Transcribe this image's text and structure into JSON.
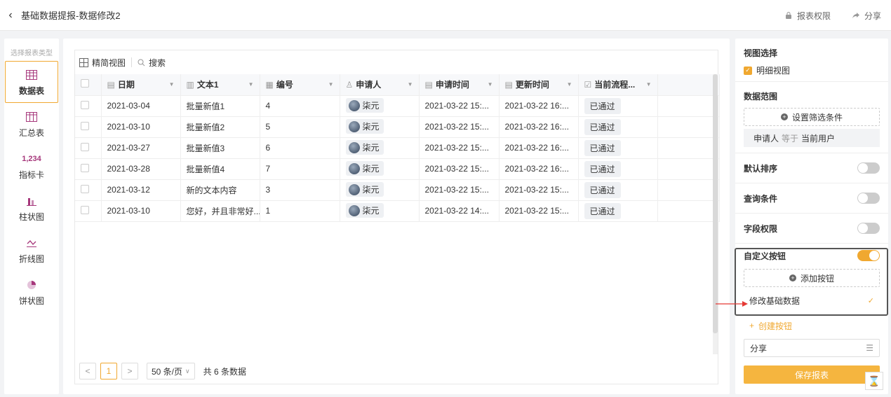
{
  "header": {
    "back_icon": "chevron-left-icon",
    "title": "基础数据提报-数据修改2",
    "actions": [
      {
        "icon": "lock-icon",
        "label": "报表权限"
      },
      {
        "icon": "share-icon",
        "label": "分享"
      }
    ]
  },
  "report_types": {
    "title": "选择报表类型",
    "items": [
      {
        "label": "数据表",
        "icon": "table-icon",
        "active": true
      },
      {
        "label": "汇总表",
        "icon": "summary-table-icon",
        "active": false
      },
      {
        "label": "指标卡",
        "icon_text": "1,234",
        "icon": "metric-card-icon",
        "active": false
      },
      {
        "label": "柱状图",
        "icon": "bar-chart-icon",
        "active": false
      },
      {
        "label": "折线图",
        "icon": "line-chart-icon",
        "active": false
      },
      {
        "label": "饼状图",
        "icon": "pie-chart-icon",
        "active": false
      }
    ]
  },
  "toolbar": {
    "compact_view": "精简视图",
    "search": "搜索"
  },
  "table": {
    "columns": [
      {
        "icon": "calendar-icon",
        "label": "日期"
      },
      {
        "icon": "text-icon",
        "label": "文本1"
      },
      {
        "icon": "number-icon",
        "label": "编号"
      },
      {
        "icon": "user-icon",
        "label": "申请人"
      },
      {
        "icon": "calendar-icon",
        "label": "申请时间"
      },
      {
        "icon": "calendar-icon",
        "label": "更新时间"
      },
      {
        "icon": "status-icon",
        "label": "当前流程..."
      }
    ],
    "rows": [
      {
        "date": "2021-03-04",
        "text": "批量新值1",
        "num": "4",
        "applicant": "柒元",
        "apply_time": "2021-03-22 15:...",
        "update_time": "2021-03-22 16:...",
        "status": "已通过"
      },
      {
        "date": "2021-03-10",
        "text": "批量新值2",
        "num": "5",
        "applicant": "柒元",
        "apply_time": "2021-03-22 15:...",
        "update_time": "2021-03-22 16:...",
        "status": "已通过"
      },
      {
        "date": "2021-03-27",
        "text": "批量新值3",
        "num": "6",
        "applicant": "柒元",
        "apply_time": "2021-03-22 15:...",
        "update_time": "2021-03-22 16:...",
        "status": "已通过"
      },
      {
        "date": "2021-03-28",
        "text": "批量新值4",
        "num": "7",
        "applicant": "柒元",
        "apply_time": "2021-03-22 15:...",
        "update_time": "2021-03-22 16:...",
        "status": "已通过"
      },
      {
        "date": "2021-03-12",
        "text": "新的文本内容",
        "num": "3",
        "applicant": "柒元",
        "apply_time": "2021-03-22 15:...",
        "update_time": "2021-03-22 15:...",
        "status": "已通过"
      },
      {
        "date": "2021-03-10",
        "text": "您好，并且非常好...",
        "num": "1",
        "applicant": "柒元",
        "apply_time": "2021-03-22 14:...",
        "update_time": "2021-03-22 15:...",
        "status": "已通过"
      }
    ]
  },
  "pagination": {
    "prev": "<",
    "current": "1",
    "next": ">",
    "page_size": "50 条/页",
    "total": "共 6 条数据"
  },
  "settings": {
    "view_select": {
      "title": "视图选择",
      "option": "明细视图",
      "checked": true
    },
    "data_range": {
      "title": "数据范围",
      "add_filter": "设置筛选条件",
      "filter": {
        "field": "申请人",
        "op": "等于",
        "value": "当前用户"
      }
    },
    "default_sort": {
      "label": "默认排序",
      "on": false
    },
    "query_conditions": {
      "label": "查询条件",
      "on": false
    },
    "field_permission": {
      "label": "字段权限",
      "on": false
    },
    "custom_buttons": {
      "label": "自定义按钮",
      "on": true,
      "add_button": "添加按钮",
      "items": [
        {
          "label": "修改基础数据",
          "selected": true
        }
      ],
      "create_button": "创建按钮"
    },
    "share_select": "分享",
    "save_button": "保存报表"
  },
  "colors": {
    "accent": "#f0a830",
    "save": "#f5b53f",
    "annotation": "#e53935",
    "highlight_border": "#555555"
  }
}
